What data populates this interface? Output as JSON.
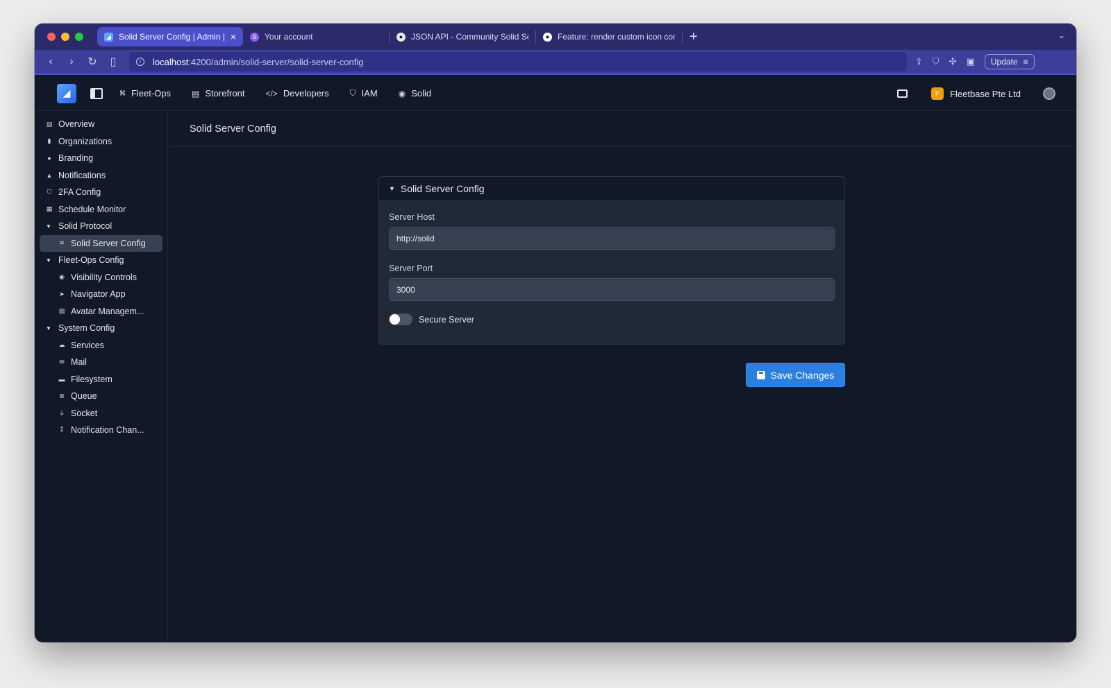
{
  "browser": {
    "tabs": [
      {
        "title": "Solid Server Config | Admin | F",
        "active": true,
        "favicon": "fleetbase-icon"
      },
      {
        "title": "Your account",
        "active": false,
        "favicon": "stripe-icon"
      },
      {
        "title": "JSON API - Community Solid Serv",
        "active": false,
        "favicon": "solid-icon"
      },
      {
        "title": "Feature: render custom icon comp",
        "active": false,
        "favicon": "github-icon"
      }
    ],
    "url_host": "localhost",
    "url_path": ":4200/admin/solid-server/solid-server-config",
    "update_label": "Update"
  },
  "header": {
    "nav": [
      {
        "label": "Fleet-Ops",
        "icon": "route-icon"
      },
      {
        "label": "Storefront",
        "icon": "store-icon"
      },
      {
        "label": "Developers",
        "icon": "code-icon"
      },
      {
        "label": "IAM",
        "icon": "shield-icon"
      },
      {
        "label": "Solid",
        "icon": "circle-dot-icon"
      }
    ],
    "org_initial": "F",
    "org_name": "Fleetbase Pte Ltd"
  },
  "sidebar": {
    "items": [
      {
        "label": "Overview",
        "icon": "overview-icon"
      },
      {
        "label": "Organizations",
        "icon": "building-icon"
      },
      {
        "label": "Branding",
        "icon": "palette-icon"
      },
      {
        "label": "Notifications",
        "icon": "bell-icon"
      },
      {
        "label": "2FA Config",
        "icon": "shield-icon"
      },
      {
        "label": "Schedule Monitor",
        "icon": "calendar-icon"
      }
    ],
    "groups": [
      {
        "label": "Solid Protocol",
        "children": [
          {
            "label": "Solid Server Config",
            "icon": "sliders-icon",
            "active": true
          }
        ]
      },
      {
        "label": "Fleet-Ops Config",
        "children": [
          {
            "label": "Visibility Controls",
            "icon": "eye-icon"
          },
          {
            "label": "Navigator App",
            "icon": "location-arrow-icon"
          },
          {
            "label": "Avatar Managem...",
            "icon": "images-icon"
          }
        ]
      },
      {
        "label": "System Config",
        "children": [
          {
            "label": "Services",
            "icon": "cloud-icon"
          },
          {
            "label": "Mail",
            "icon": "envelope-icon"
          },
          {
            "label": "Filesystem",
            "icon": "hdd-icon"
          },
          {
            "label": "Queue",
            "icon": "layers-icon"
          },
          {
            "label": "Socket",
            "icon": "plug-icon"
          },
          {
            "label": "Notification Chan...",
            "icon": "broadcast-icon"
          }
        ]
      }
    ]
  },
  "main": {
    "page_title": "Solid Server Config",
    "panel_title": "Solid Server Config",
    "server_host_label": "Server Host",
    "server_host_value": "http://solid",
    "server_port_label": "Server Port",
    "server_port_value": "3000",
    "secure_server_label": "Secure Server",
    "secure_server_enabled": false,
    "save_label": "Save Changes"
  },
  "colors": {
    "accent": "#2b7fe0",
    "background": "#111827",
    "panel": "#1f2937",
    "tabbar": "#2b2a6b"
  }
}
